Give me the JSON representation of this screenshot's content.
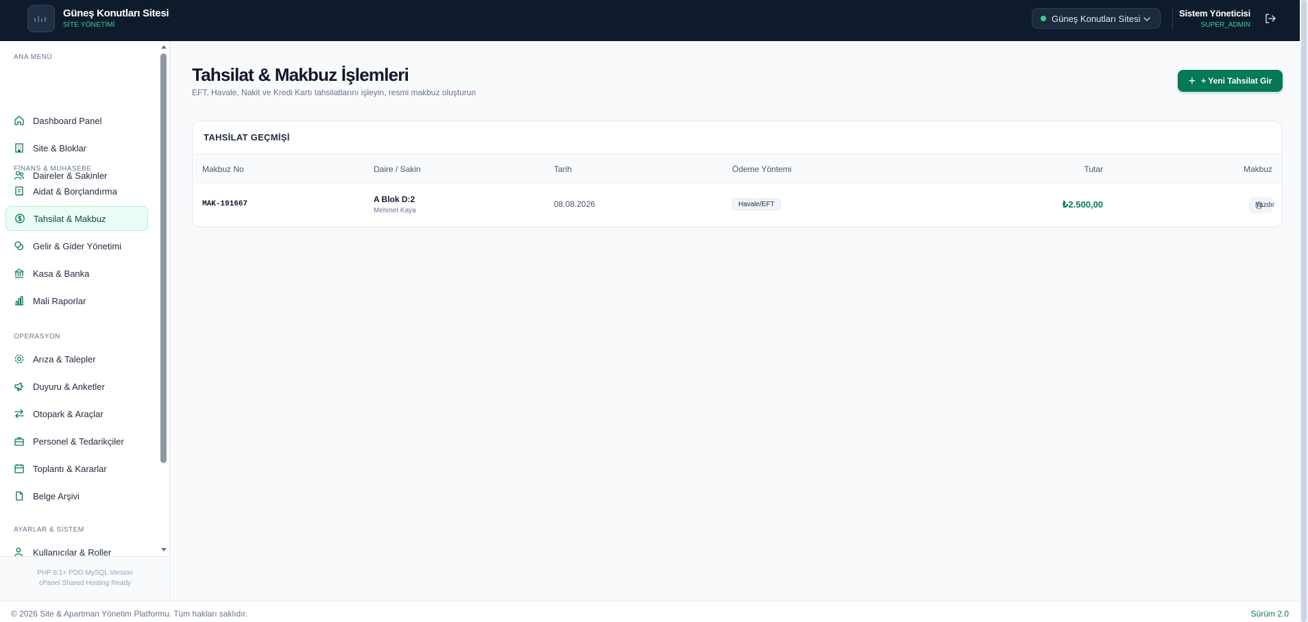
{
  "colors": {
    "header_bg": "#0f1b2d",
    "accent": "#047857",
    "accent_light": "#34d399",
    "active_bg": "#ecfdf5"
  },
  "header": {
    "logo_icon": "building-logo-icon",
    "title": "Güneş Konutları Sitesi",
    "subtitle": "SİTE YÖNETİMİ",
    "site_selector": {
      "value": "Güneş Konutları Sitesi",
      "icon": "chevron-down-icon"
    },
    "user": {
      "name": "Sistem Yöneticisi",
      "role": "SUPER_ADMIN"
    },
    "logout_icon": "logout-icon"
  },
  "sidebar": {
    "sections": [
      {
        "title": "ANA MENÜ"
      },
      {
        "title": "FİNANS & MUHASEBE"
      },
      {
        "title": "OPERASYON"
      },
      {
        "title": "AYARLAR & SİSTEM"
      }
    ],
    "items": [
      {
        "label": "Dashboard Panel",
        "icon": "home-icon"
      },
      {
        "label": "Site & Bloklar",
        "icon": "building-icon"
      },
      {
        "label": "Daireler & Sakinler",
        "icon": "users-icon"
      },
      {
        "label": "Aidat & Borçlandırma",
        "icon": "receipt-icon"
      },
      {
        "label": "Tahsilat & Makbuz",
        "icon": "dollar-circle-icon",
        "active": true
      },
      {
        "label": "Gelir & Gider Yönetimi",
        "icon": "coins-icon"
      },
      {
        "label": "Kasa & Banka",
        "icon": "bank-icon"
      },
      {
        "label": "Mali Raporlar",
        "icon": "bar-chart-icon"
      },
      {
        "label": "Arıza & Talepler",
        "icon": "gear-icon"
      },
      {
        "label": "Duyuru & Anketler",
        "icon": "megaphone-icon"
      },
      {
        "label": "Otopark & Araçlar",
        "icon": "swap-arrows-icon"
      },
      {
        "label": "Personel & Tedarikçiler",
        "icon": "briefcase-icon"
      },
      {
        "label": "Toplantı & Kararlar",
        "icon": "calendar-icon"
      },
      {
        "label": "Belge Arşivi",
        "icon": "file-icon"
      },
      {
        "label": "Kullanıcılar & Roller",
        "icon": "user-roles-icon"
      }
    ],
    "footer": {
      "line1": "PHP 8.1+ PDO MySQL Version",
      "line2": "cPanel Shared Hosting Ready"
    }
  },
  "main": {
    "title": "Tahsilat & Makbuz İşlemleri",
    "subtitle": "EFT, Havale, Nakit ve Kredi Kartı tahsilatlarını işleyin, resmi makbuz oluşturun",
    "new_button": "+ Yeni Tahsilat Gir",
    "table": {
      "title": "TAHSİLAT GEÇMİŞİ",
      "headers": [
        "Makbuz No",
        "Daire / Sakin",
        "Tarih",
        "Ödeme Yöntemi",
        "Tutar",
        "Makbuz"
      ],
      "rows": [
        {
          "makbuz_no": "MAK-191667",
          "daire": "A Blok D:2",
          "sakin": "Mehmet Kaya",
          "tarih": "08.08.2026",
          "yontem": "Havale/EFT",
          "tutar": "₺2.500,00",
          "action": "Yazdır"
        }
      ]
    }
  },
  "footer": {
    "copyright": "© 2026 Site & Apartman Yönetim Platformu. Tüm hakları saklıdır.",
    "version": "Sürüm 2.0"
  }
}
